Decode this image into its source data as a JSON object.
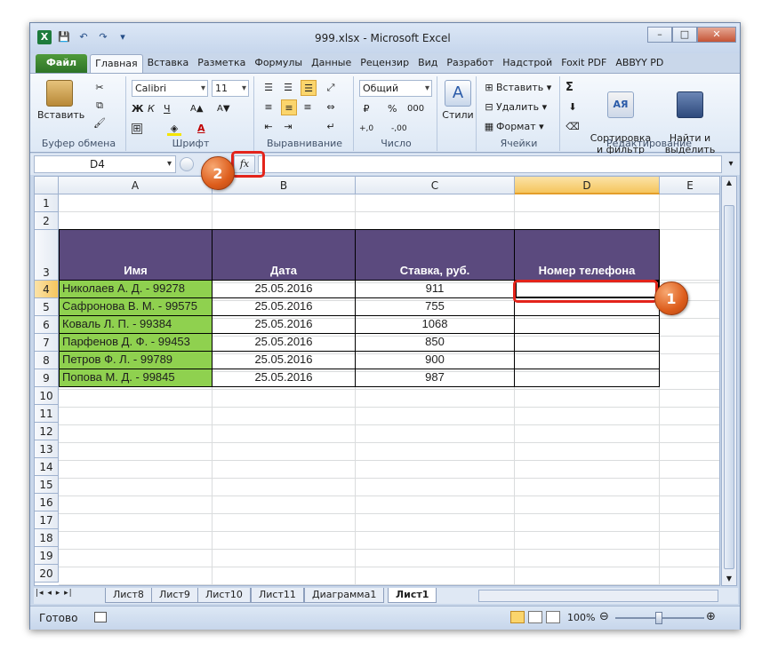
{
  "window": {
    "title": "999.xlsx - Microsoft Excel",
    "minimize": "–",
    "restore": "□",
    "close": "✕"
  },
  "qat": {
    "app_icon": "X",
    "save_icon": "💾",
    "undo_icon": "↶",
    "redo_icon": "↷",
    "customize_icon": "▾"
  },
  "ribbon_tabs": [
    "Файл",
    "Главная",
    "Вставка",
    "Разметка",
    "Формулы",
    "Данные",
    "Рецензир",
    "Вид",
    "Разработ",
    "Надстрой",
    "Foxit PDF",
    "ABBYY PD"
  ],
  "ribbon": {
    "clipboard": {
      "label": "Буфер обмена",
      "paste": "Вставить"
    },
    "font": {
      "label": "Шрифт",
      "name": "Calibri",
      "size": "11",
      "bold": "Ж",
      "italic": "К",
      "underline": "Ч",
      "grow": "A▲",
      "shrink": "A▼",
      "color": "A"
    },
    "alignment": {
      "label": "Выравнивание"
    },
    "number": {
      "label": "Число",
      "format": "Общий",
      "percent": "%",
      "comma": "000",
      "dec_inc": "+,0",
      "dec_dec": "-,00"
    },
    "styles": {
      "label": "Стили"
    },
    "cells": {
      "label": "Ячейки",
      "insert": "Вставить",
      "delete": "Удалить",
      "format": "Формат"
    },
    "editing": {
      "label": "Редактирование",
      "sum": "Σ",
      "sort": "Сортировка\nи фильтр",
      "find": "Найти и\nвыделить"
    }
  },
  "formula_bar": {
    "name_box": "D4",
    "fx": "fx",
    "formula": ""
  },
  "columns": [
    "A",
    "B",
    "C",
    "D",
    "E"
  ],
  "rows": [
    "1",
    "2",
    "3",
    "4",
    "5",
    "6",
    "7",
    "8",
    "9",
    "10",
    "11",
    "12",
    "13",
    "14",
    "15",
    "16",
    "17",
    "18",
    "19",
    "20"
  ],
  "table": {
    "headers": [
      "Имя",
      "Дата",
      "Ставка, руб.",
      "Номер телефона"
    ],
    "rows": [
      [
        "Николаев А. Д. - 99278",
        "25.05.2016",
        "911",
        ""
      ],
      [
        "Сафронова В. М. - 99575",
        "25.05.2016",
        "755",
        ""
      ],
      [
        "Коваль Л. П. - 99384",
        "25.05.2016",
        "1068",
        ""
      ],
      [
        "Парфенов Д. Ф. - 99453",
        "25.05.2016",
        "850",
        ""
      ],
      [
        "Петров Ф. Л. - 99789",
        "25.05.2016",
        "900",
        ""
      ],
      [
        "Попова М. Д. - 99845",
        "25.05.2016",
        "987",
        ""
      ]
    ]
  },
  "sheets": [
    "Лист8",
    "Лист9",
    "Лист10",
    "Лист11",
    "Диаграмма1",
    "Лист1"
  ],
  "active_sheet": "Лист1",
  "status": {
    "ready": "Готово",
    "zoom": "100%",
    "minus": "⊖",
    "plus": "⊕"
  },
  "callouts": {
    "one": "1",
    "two": "2"
  },
  "colors": {
    "header_fill": "#5b4a7e",
    "name_fill": "#8fd14f",
    "callout": "#dd5d1c",
    "highlight": "#e3241b"
  }
}
